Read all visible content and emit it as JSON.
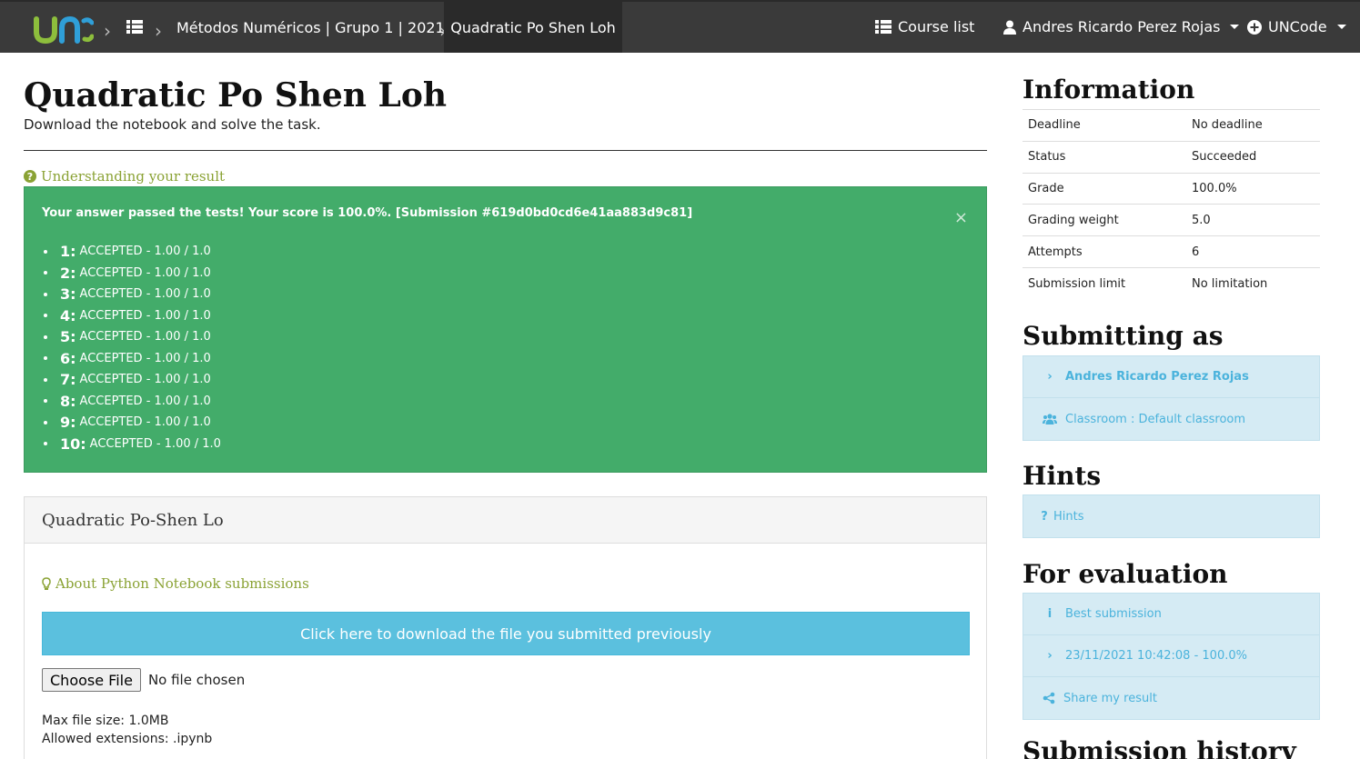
{
  "colors": {
    "navbar": "#3a3a3a",
    "success": "#43ac6a",
    "info": "#5bc0de",
    "link_green": "#8aa234",
    "list_blue": "#4bb3dc"
  },
  "nav": {
    "course_title": "Métodos Numéricos | Grupo 1 | 2021...",
    "task_title": "Quadratic Po Shen Loh",
    "course_list": "Course list",
    "user": "Andres Ricardo Perez Rojas",
    "brand": "UNCode"
  },
  "task": {
    "title": "Quadratic Po Shen Loh",
    "subtitle": "Download the notebook and solve the task.",
    "understanding_link": "Understanding your result"
  },
  "result": {
    "message": "Your answer passed the tests! Your score is 100.0%. [Submission #619d0bd0cd6e41aa883d9c81]",
    "tests": [
      {
        "num": "1:",
        "text": "ACCEPTED - 1.00 / 1.0"
      },
      {
        "num": "2:",
        "text": "ACCEPTED - 1.00 / 1.0"
      },
      {
        "num": "3:",
        "text": "ACCEPTED - 1.00 / 1.0"
      },
      {
        "num": "4:",
        "text": "ACCEPTED - 1.00 / 1.0"
      },
      {
        "num": "5:",
        "text": "ACCEPTED - 1.00 / 1.0"
      },
      {
        "num": "6:",
        "text": "ACCEPTED - 1.00 / 1.0"
      },
      {
        "num": "7:",
        "text": "ACCEPTED - 1.00 / 1.0"
      },
      {
        "num": "8:",
        "text": "ACCEPTED - 1.00 / 1.0"
      },
      {
        "num": "9:",
        "text": "ACCEPTED - 1.00 / 1.0"
      },
      {
        "num": "10:",
        "text": "ACCEPTED - 1.00 / 1.0"
      }
    ]
  },
  "panel": {
    "title": "Quadratic Po-Shen Lo",
    "about_link": "About Python Notebook submissions",
    "download_label": "Click here to download the file you submitted previously",
    "choose_file": "Choose File",
    "no_file": "No file chosen",
    "max_size": "Max file size: 1.0MB",
    "extensions": "Allowed extensions: .ipynb"
  },
  "sidebar": {
    "info_title": "Information",
    "info_rows": [
      {
        "label": "Deadline",
        "value": "No deadline"
      },
      {
        "label": "Status",
        "value": "Succeeded"
      },
      {
        "label": "Grade",
        "value": "100.0%"
      },
      {
        "label": "Grading weight",
        "value": "5.0"
      },
      {
        "label": "Attempts",
        "value": "6"
      },
      {
        "label": "Submission limit",
        "value": "No limitation"
      }
    ],
    "submitting_title": "Submitting as",
    "submitting_user": "Andres Ricardo Perez Rojas",
    "classroom": "Classroom : Default classroom",
    "hints_title": "Hints",
    "hints_item": "Hints",
    "eval_title": "For evaluation",
    "best_submission": "Best submission",
    "eval_submission": "23/11/2021 10:42:08 - 100.0%",
    "share": "Share my result",
    "history_title": "Submission history"
  }
}
